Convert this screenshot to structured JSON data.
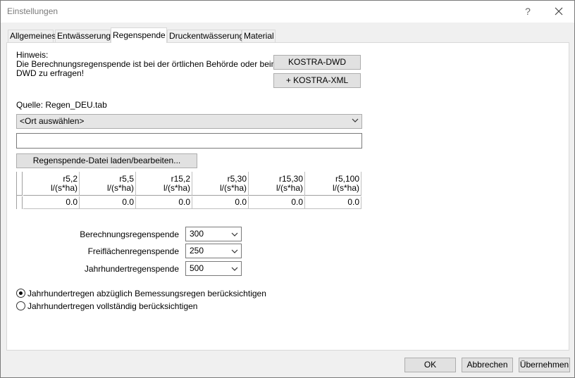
{
  "window": {
    "title": "Einstellungen",
    "help_label": "?"
  },
  "tabs": [
    {
      "label": "Allgemeines"
    },
    {
      "label": "Entwässerung"
    },
    {
      "label": "Regenspende"
    },
    {
      "label": "Druckentwässerung"
    },
    {
      "label": "Material"
    }
  ],
  "active_tab": "Regenspende",
  "hint": {
    "heading": "Hinweis:",
    "line1": "Die Berechnungsregenspende ist bei der örtlichen Behörde oder beim",
    "line2": "DWD zu erfragen!"
  },
  "buttons": {
    "kostra_dwd": "KOSTRA-DWD",
    "kostra_xml": "+ KOSTRA-XML",
    "load_edit": "Regenspende-Datei laden/bearbeiten...",
    "ok": "OK",
    "cancel": "Abbrechen",
    "apply": "Übernehmen"
  },
  "source": "Quelle: Regen_DEU.tab",
  "location_combo": "<Ort auswählen>",
  "location_text": "",
  "grid": {
    "columns": [
      {
        "name": "r5,2",
        "unit": "l/(s*ha)"
      },
      {
        "name": "r5,5",
        "unit": "l/(s*ha)"
      },
      {
        "name": "r15,2",
        "unit": "l/(s*ha)"
      },
      {
        "name": "r5,30",
        "unit": "l/(s*ha)"
      },
      {
        "name": "r15,30",
        "unit": "l/(s*ha)"
      },
      {
        "name": "r5,100",
        "unit": "l/(s*ha)"
      }
    ],
    "values": [
      "0.0",
      "0.0",
      "0.0",
      "0.0",
      "0.0",
      "0.0"
    ]
  },
  "params": {
    "berechnung_label": "Berechnungsregenspende",
    "berechnung_value": "300",
    "freiflaechen_label": "Freiflächenregenspende",
    "freiflaechen_value": "250",
    "jahrhundert_label": "Jahrhundertregenspende",
    "jahrhundert_value": "500"
  },
  "options": {
    "option1": "Jahrhundertregen abzüglich Bemessungsregen berücksichtigen",
    "option2": "Jahrhundertregen vollständig berücksichtigen",
    "selected": 1
  }
}
